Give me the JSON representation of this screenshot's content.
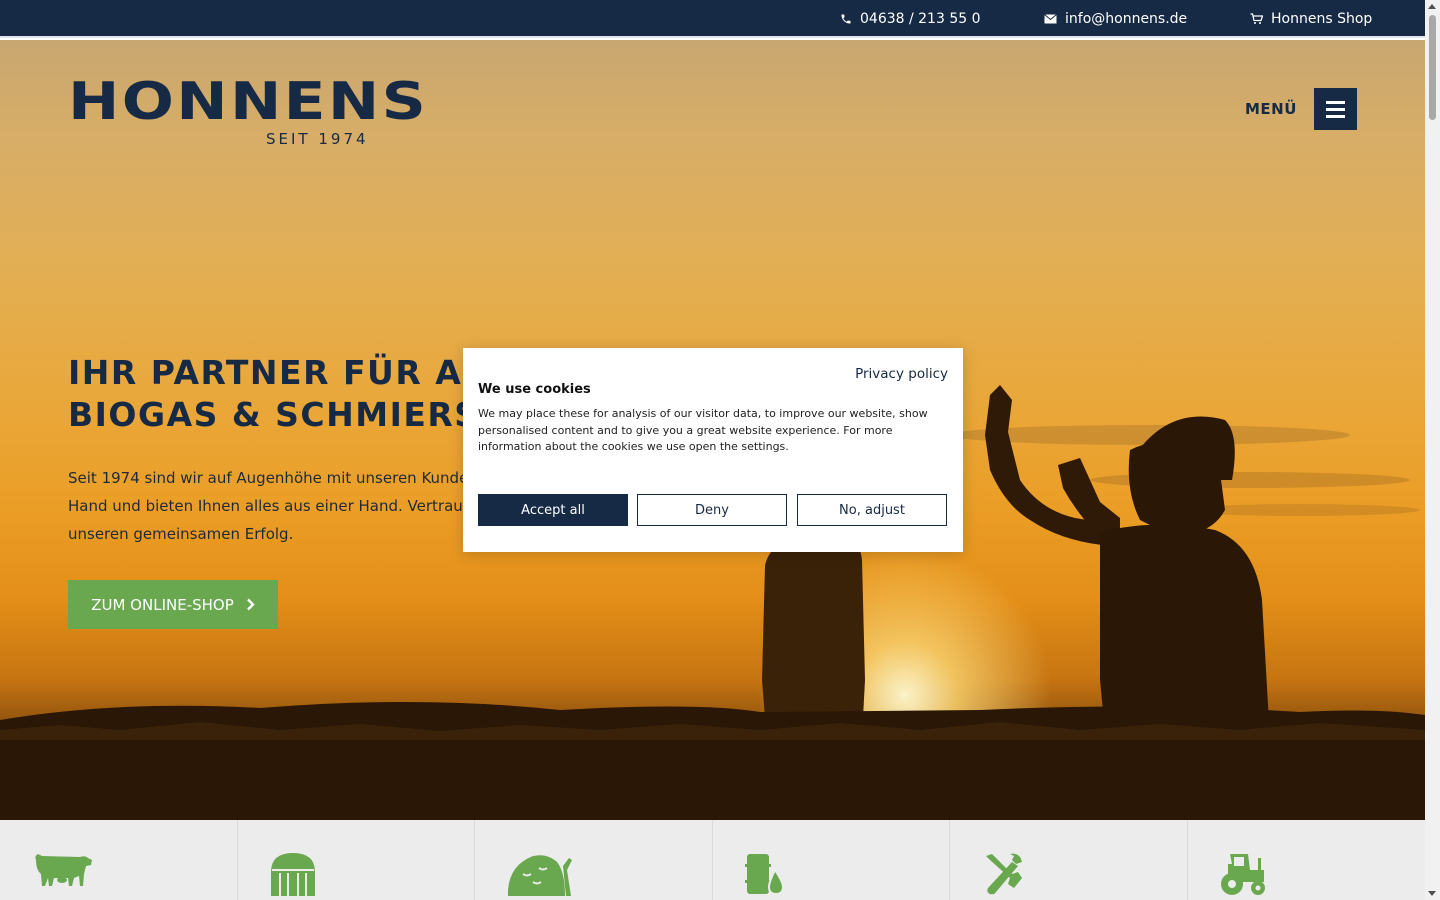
{
  "topbar": {
    "phone": "04638 / 213 55 0",
    "email": "info@honnens.de",
    "shop": "Honnens Shop"
  },
  "header": {
    "brand": "HONNENS",
    "since": "SEIT 1974",
    "menu_label": "MENÜ"
  },
  "hero": {
    "headline_line1": "IHR PARTNER FÜR AGR",
    "headline_line2": "BIOGAS & SCHMIERSTO",
    "intro_line1": "Seit 1974 sind wir auf Augenhöhe mit unseren Kunden. Wir",
    "intro_line2": "Hand und bieten Ihnen alles aus einer Hand. Vertrauen ist d",
    "intro_line3": "unseren gemeinsamen Erfolg.",
    "cta_label": "ZUM ONLINE-SHOP"
  },
  "categories": [
    {
      "icon": "cow-icon"
    },
    {
      "icon": "barn-icon"
    },
    {
      "icon": "silage-icon"
    },
    {
      "icon": "lubricant-icon"
    },
    {
      "icon": "tools-icon"
    },
    {
      "icon": "tractor-icon"
    }
  ],
  "cookie": {
    "privacy_link": "Privacy policy",
    "title": "We use cookies",
    "text": "We may place these for analysis of our visitor data, to improve our website, show personalised content and to give you a great website experience. For more information about the cookies we use open the settings.",
    "accept_label": "Accept all",
    "deny_label": "Deny",
    "adjust_label": "No, adjust"
  },
  "colors": {
    "navy": "#162a45",
    "green": "#6aa84f",
    "strip": "#ececec"
  }
}
